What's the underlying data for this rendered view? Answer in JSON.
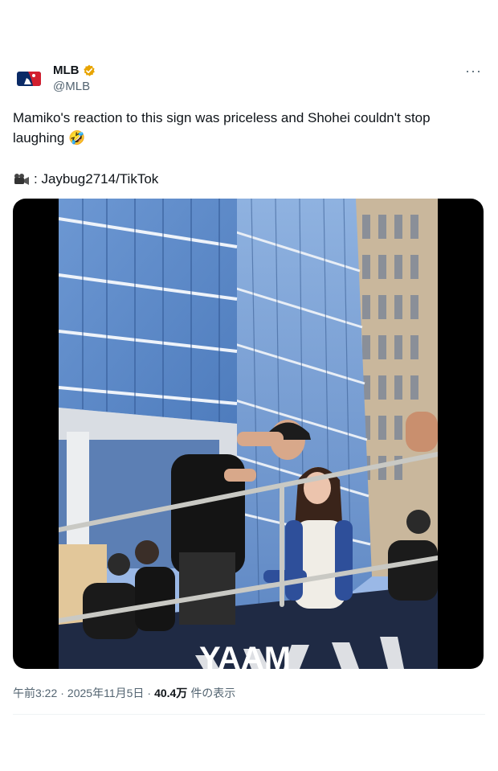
{
  "account": {
    "display_name": "MLB",
    "handle": "@MLB",
    "verified_color": "#e8a400"
  },
  "post": {
    "text": "Mamiko's reaction to this sign was priceless and Shohei couldn't stop laughing 🤣",
    "credit": ": Jaybug2714/TikTok",
    "more_label": "···",
    "media_overlay_text": "YAAM"
  },
  "meta": {
    "time": "午前3:22",
    "sep1": "·",
    "date": "2025年11月5日",
    "sep2": "·",
    "views": "40.4万",
    "views_label": "件の表示"
  },
  "icons": {
    "avatar": "mlb-logo-icon",
    "verified": "verified-badge-icon",
    "credit": "video-camera-icon",
    "more": "more-options-icon"
  }
}
